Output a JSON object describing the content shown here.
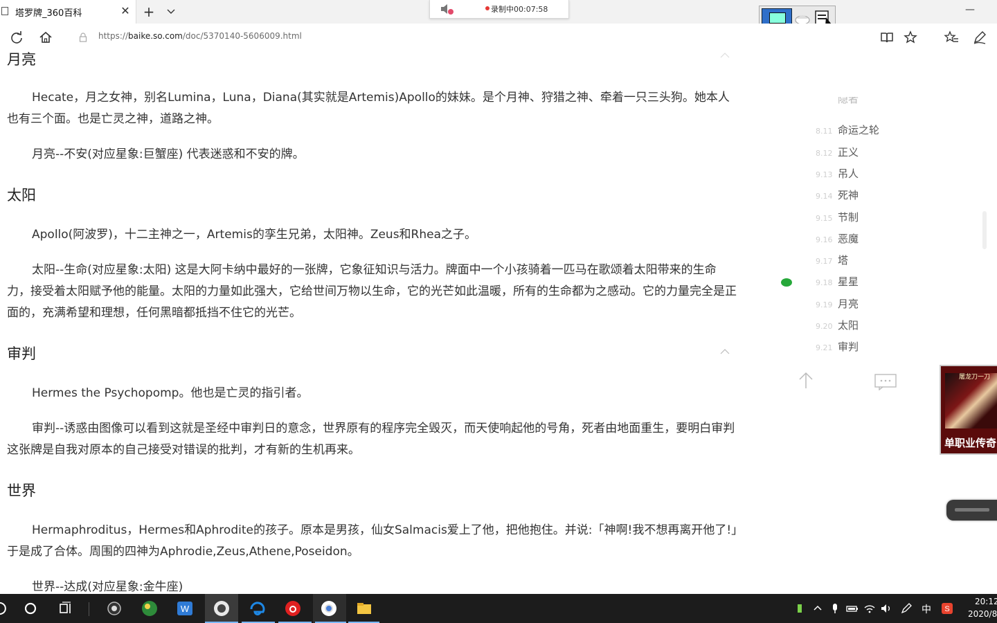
{
  "browser": {
    "tab_title": "塔罗牌_360百科",
    "url_prefix": "https://",
    "url_host": "baike.so.com",
    "url_path": "/doc/5370140-5606009.html"
  },
  "recording": {
    "text": "录制中00:07:58"
  },
  "sections": [
    {
      "title": "月亮",
      "paragraphs": [
        "Hecate，月之女神，别名Lumina，Luna，Diana(其实就是Artemis)Apollo的妹妹。是个月神、狩猎之神、牵着一只三头狗。她本人也有三个面。也是亡灵之神，道路之神。",
        "月亮--不安(对应星象:巨蟹座) 代表迷惑和不安的牌。"
      ]
    },
    {
      "title": "太阳",
      "paragraphs": [
        "Apollo(阿波罗)，十二主神之一，Artemis的孪生兄弟，太阳神。Zeus和Rhea之子。",
        "太阳--生命(对应星象:太阳) 这是大阿卡纳中最好的一张牌，它象征知识与活力。牌面中一个小孩骑着一匹马在歌颂着太阳带来的生命力，接受着太阳赋予他的能量。太阳的力量如此强大，它给世间万物以生命，它的光芒如此温暖，所有的生命都为之感动。它的力量完全是正面的，充满希望和理想，任何黑暗都抵挡不住它的光芒。"
      ]
    },
    {
      "title": "审判",
      "paragraphs": [
        "Hermes the Psychopomp。他也是亡灵的指引者。",
        "审判--诱惑由图像可以看到这就是圣经中审判日的意念，世界原有的程序完全毁灭，而天使响起他的号角，死者由地面重生，要明白审判这张牌是自我对原本的自己接受对错误的批判，才有新的生机再来。"
      ]
    },
    {
      "title": "世界",
      "paragraphs": [
        "Hermaphroditus，Hermes和Aphrodite的孩子。原本是男孩，仙女Salmacis爱上了他，把他抱住。并说:「神啊!我不想再离开他了!」于是成了合体。周围的四神为Aphrodie,Zeus,Athene,Poseidon。",
        "世界--达成(对应星象:金牛座)"
      ]
    }
  ],
  "toc": [
    {
      "num": "",
      "label": "隐者",
      "faded": true
    },
    {
      "num": "8.11",
      "label": "命运之轮",
      "faded": false
    },
    {
      "num": "8.12",
      "label": "正义",
      "faded": false
    },
    {
      "num": "9.13",
      "label": "吊人",
      "faded": false
    },
    {
      "num": "9.14",
      "label": "死神",
      "faded": false
    },
    {
      "num": "9.15",
      "label": "节制",
      "faded": false
    },
    {
      "num": "9.16",
      "label": "恶魔",
      "faded": false
    },
    {
      "num": "9.17",
      "label": "塔",
      "faded": false
    },
    {
      "num": "9.18",
      "label": "星星",
      "faded": false
    },
    {
      "num": "9.19",
      "label": "月亮",
      "faded": false
    },
    {
      "num": "9.20",
      "label": "太阳",
      "faded": false
    },
    {
      "num": "9.21",
      "label": "审判",
      "faded": false
    }
  ],
  "ad": {
    "badge": "屠龙刀一刀",
    "text": "单职业传奇"
  },
  "taskbar": {
    "ime": "中",
    "time": "20:12",
    "date": "2020/8"
  }
}
